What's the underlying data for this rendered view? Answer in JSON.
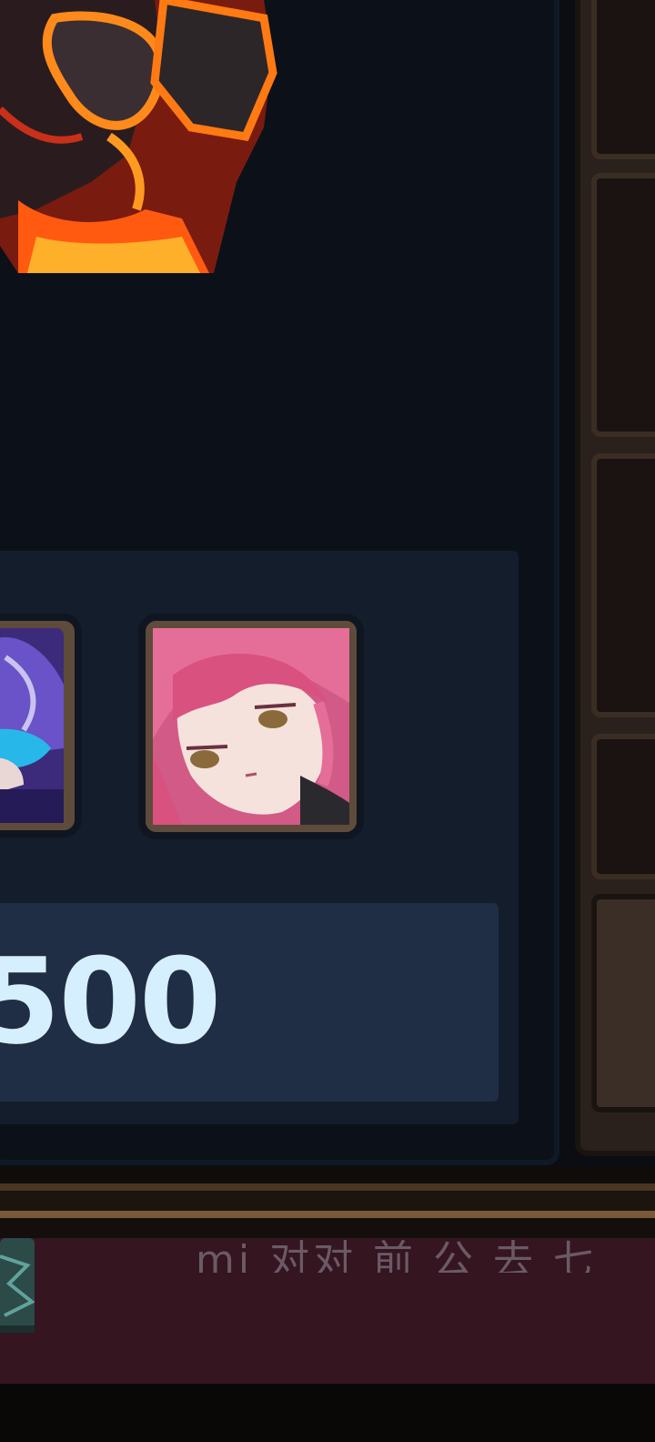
{
  "shop_card": {
    "price_text": "500"
  },
  "footer": {
    "text": "mi 对对 前 公 去 七"
  },
  "colors": {
    "panel_bg": "#0c1119",
    "card_bg": "#141d2b",
    "price_bar": "#1f2d45",
    "price_text": "#d6efff",
    "footer_bg": "#341520",
    "frame_brown": "#5e4b3b"
  },
  "icons": {
    "boss": "fire-golem-icon",
    "portrait_left": "character-portrait-purple-icon",
    "portrait_right": "character-portrait-pink-hair-icon"
  }
}
